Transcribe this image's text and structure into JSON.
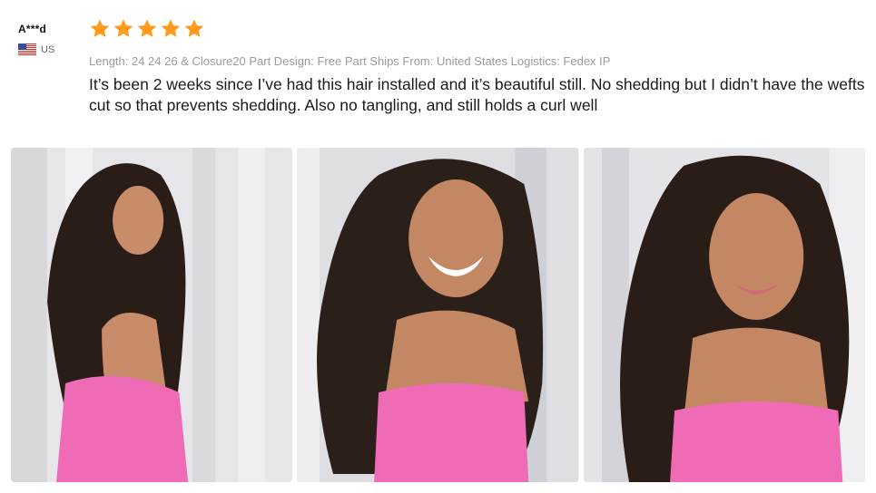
{
  "review": {
    "reviewer_name": "A***d",
    "country": "US",
    "rating": 5,
    "star_icon": "star-icon",
    "star_color": "#ff9a1a",
    "meta": "Length: 24 24 26 & Closure20 Part Design: Free Part Ships From: United States Logistics: Fedex IP",
    "text": "It’s been 2 weeks since I’ve had this hair installed and it’s beautiful still. No shedding but I didn’t have the wefts cut so that prevents shedding. Also no tangling, and still holds a curl well"
  },
  "photos": [
    {
      "name": "review-photo-1"
    },
    {
      "name": "review-photo-2"
    },
    {
      "name": "review-photo-3"
    }
  ]
}
